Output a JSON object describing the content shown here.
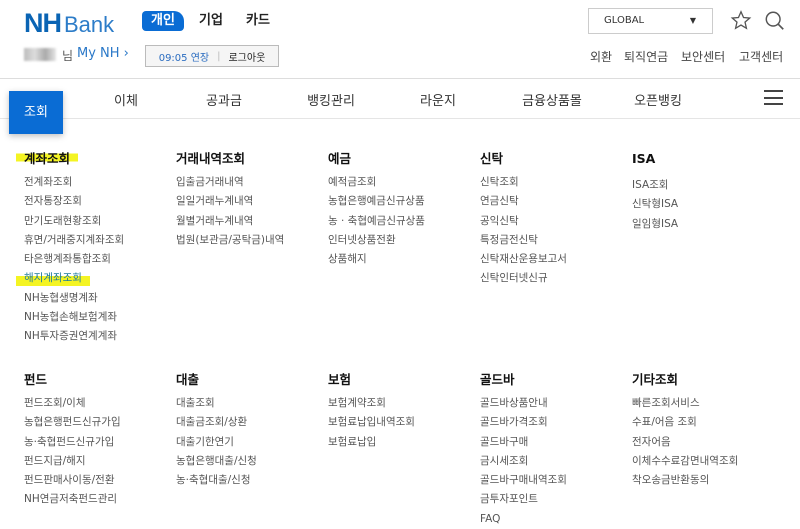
{
  "header": {
    "logo_nh": "NH",
    "logo_bank": "Bank",
    "segments": [
      "개인",
      "기업",
      "카드"
    ],
    "language": "GLOBAL",
    "user_suffix": "님",
    "my_nh": "My NH ›",
    "session_time": "09:05 연장",
    "logout": "로그아웃",
    "links": [
      "외환",
      "퇴직연금",
      "보안센터",
      "고객센터"
    ]
  },
  "nav": {
    "active": "조회",
    "items": [
      "이체",
      "공과금",
      "뱅킹관리",
      "라운지",
      "금융상품몰",
      "오픈뱅킹"
    ]
  },
  "menu": [
    {
      "title": "계좌조회",
      "items": [
        "전계좌조회",
        "전자통장조회",
        "만기도래현황조회",
        "휴면/거래중지계좌조회",
        "타은행계좌통합조회",
        "해지계좌조회",
        "NH농협생명계좌",
        "NH농협손해보험계좌",
        "NH투자증권연계계좌"
      ]
    },
    {
      "title": "거래내역조회",
      "items": [
        "입출금거래내역",
        "일일거래누계내역",
        "월별거래누계내역",
        "법원(보관금/공탁금)내역"
      ]
    },
    {
      "title": "예금",
      "items": [
        "예적금조회",
        "농협은행예금신규상품",
        "농 · 축협예금신규상품",
        "인터넷상품전환",
        "상품해지"
      ]
    },
    {
      "title": "신탁",
      "items": [
        "신탁조회",
        "연금신탁",
        "공익신탁",
        "특정금전신탁",
        "신탁재산운용보고서",
        "신탁인터넷신규"
      ]
    },
    {
      "title": "ISA",
      "items": [
        "ISA조회",
        "신탁형ISA",
        "일임형ISA"
      ]
    },
    {
      "title": "펀드",
      "items": [
        "펀드조회/이체",
        "농협은행펀드신규가입",
        "농·축협펀드신규가입",
        "펀드지급/해지",
        "펀드판매사이동/전환",
        "NH연금저축펀드관리"
      ]
    },
    {
      "title": "대출",
      "items": [
        "대출조회",
        "대출금조회/상환",
        "대출기한연기",
        "농협은행대출/신청",
        "농·축협대출/신청"
      ]
    },
    {
      "title": "보험",
      "items": [
        "보험계약조회",
        "보험료납입내역조회",
        "보험료납입"
      ]
    },
    {
      "title": "골드바",
      "items": [
        "골드바상품안내",
        "골드바가격조회",
        "골드바구매",
        "금시세조회",
        "골드바구매내역조회",
        "금투자포인트",
        "FAQ"
      ]
    },
    {
      "title": "기타조회",
      "items": [
        "빠른조회서비스",
        "수표/어음 조회",
        "전자어음",
        "이체수수료감면내역조회",
        "착오송금반환동의"
      ]
    }
  ],
  "highlighted": [
    "계좌조회",
    "해지계좌조회"
  ]
}
